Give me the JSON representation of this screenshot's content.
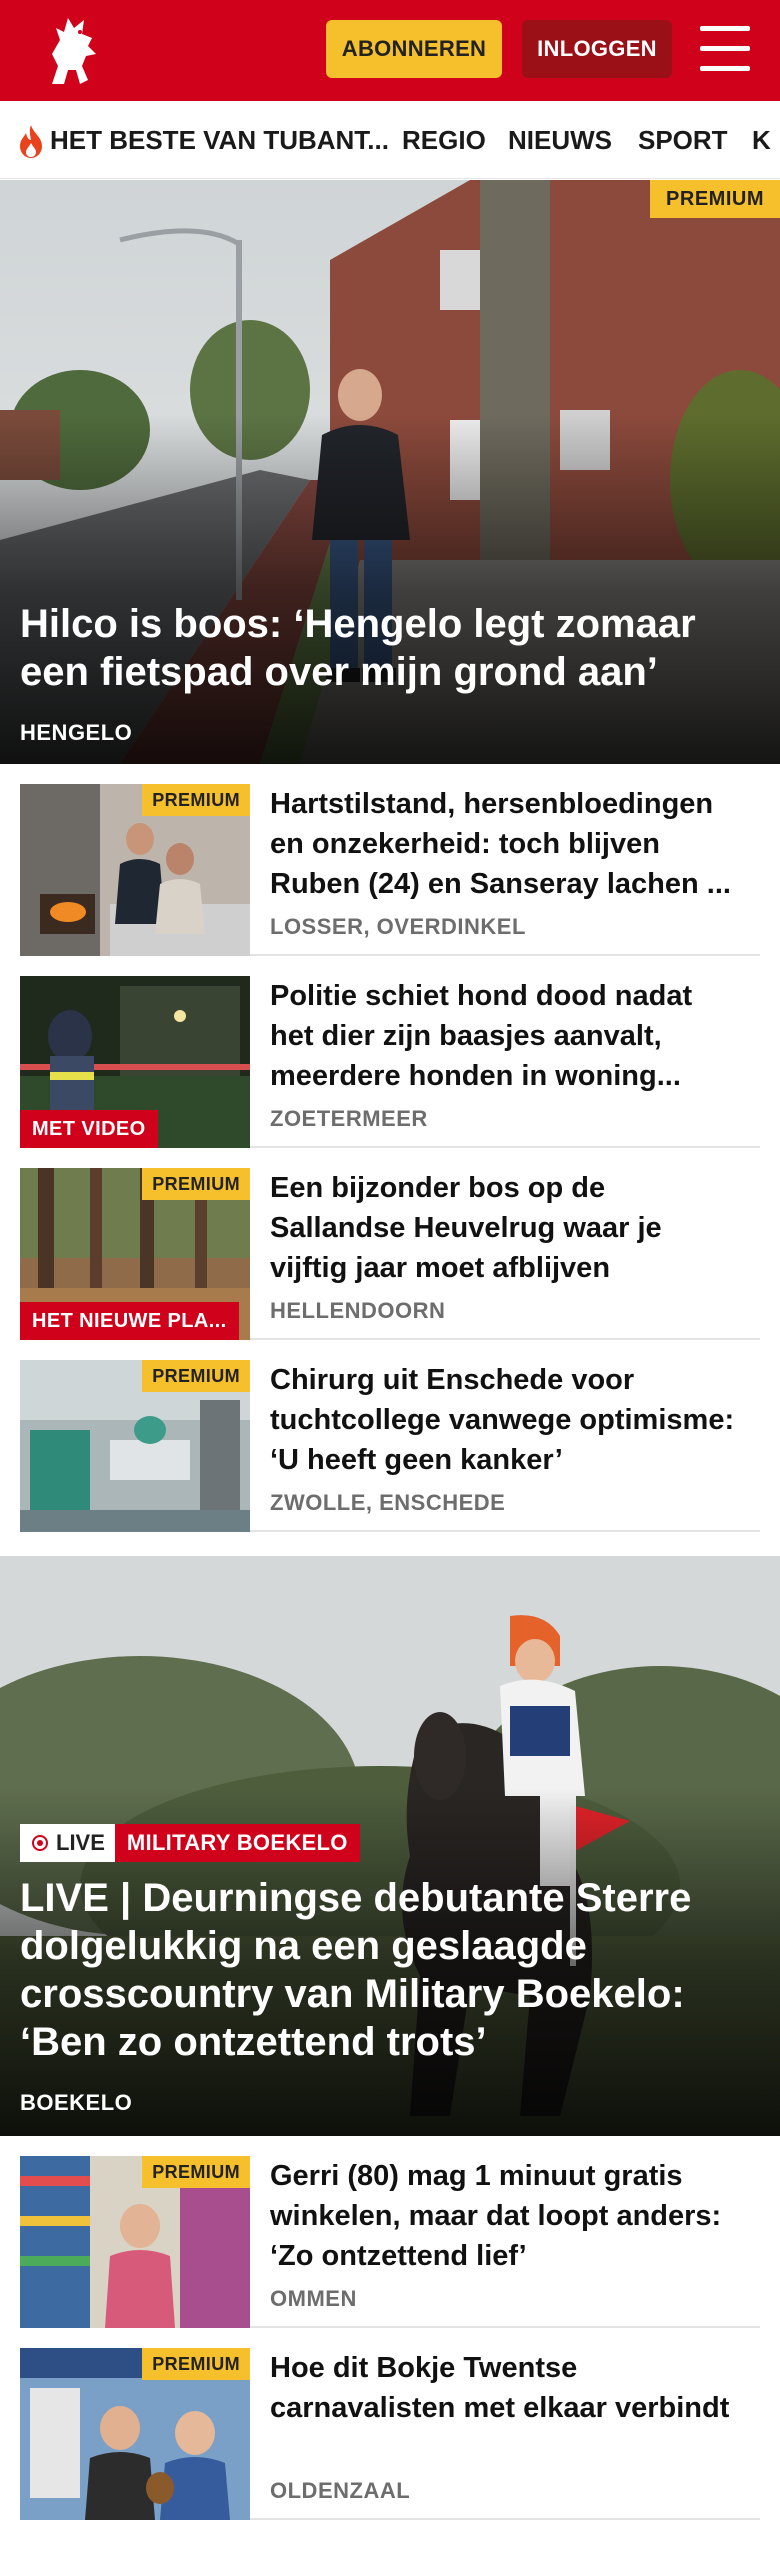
{
  "header": {
    "logo_alt": "Tubantia logo",
    "subscribe_label": "ABONNEREN",
    "login_label": "INLOGGEN",
    "menu_icon": "hamburger-menu-icon",
    "brand_color": "#d0021b"
  },
  "nav": {
    "items": [
      {
        "label": "HET BESTE VAN TUBANT..."
      },
      {
        "label": "REGIO"
      },
      {
        "label": "NIEUWS"
      },
      {
        "label": "SPORT"
      },
      {
        "label": "K"
      }
    ]
  },
  "hero1": {
    "badge": "PREMIUM",
    "title": "Hilco is boos: ‘Hengelo legt zomaar een fietspad over mijn grond aan’",
    "location": "HENGELO"
  },
  "articles_a": [
    {
      "title": "Hartstilstand, hersenbloedingen en onzekerheid: toch blijven Ruben (24) en Sanseray lachen ...",
      "location": "LOSSER, OVERDINKEL",
      "premium": "PREMIUM",
      "tag": ""
    },
    {
      "title": "Politie schiet hond dood nadat het dier zijn baasjes aanvalt, meerdere honden in woning...",
      "location": "ZOETERMEER",
      "premium": "",
      "tag": "MET VIDEO"
    },
    {
      "title": "Een bijzonder bos op de Sallandse Heuvelrug waar je vijftig jaar moet afblijven",
      "location": "HELLENDOORN",
      "premium": "PREMIUM",
      "tag": "HET NIEUWE PLA..."
    },
    {
      "title": "Chirurg uit Enschede voor tuchtcollege vanwege optimisme: ‘U heeft geen kanker’",
      "location": "ZWOLLE, ENSCHEDE",
      "premium": "PREMIUM",
      "tag": ""
    }
  ],
  "hero2": {
    "live_label": "LIVE",
    "category": "MILITARY BOEKELO",
    "title": "LIVE | Deurningse debutante Sterre dolgelukkig na een geslaagde crosscountry van Military Boekelo: ‘Ben zo ontzettend trots’",
    "location": "BOEKELO"
  },
  "articles_b": [
    {
      "title": "Gerri (80) mag 1 minuut gratis winkelen, maar dat loopt anders: ‘Zo ontzettend lief’",
      "location": "OMMEN",
      "premium": "PREMIUM",
      "tag": ""
    },
    {
      "title": "Hoe dit Bokje Twentse carnavalisten met elkaar verbindt",
      "location": "OLDENZAAL",
      "premium": "PREMIUM",
      "tag": ""
    }
  ]
}
